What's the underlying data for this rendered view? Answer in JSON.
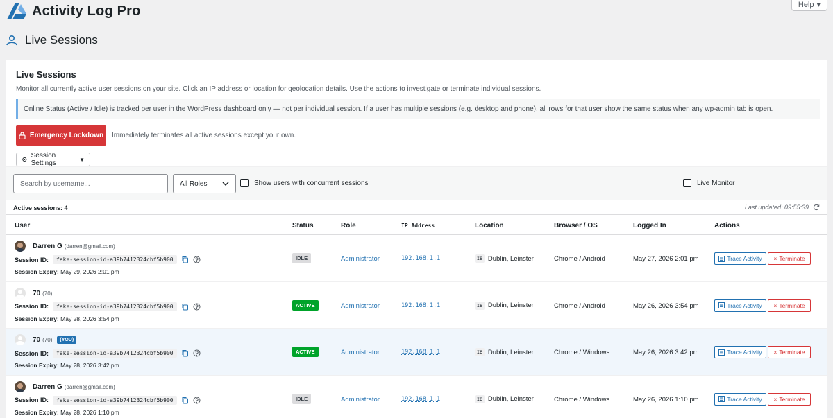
{
  "app": {
    "name": "Activity Log Pro"
  },
  "help": {
    "label": "Help"
  },
  "page": {
    "title": "Live Sessions"
  },
  "card": {
    "title": "Live Sessions",
    "description": "Monitor all currently active user sessions on your site. Click an IP address or location for geolocation details. Use the actions to investigate or terminate individual sessions.",
    "notice": "Online Status (Active / Idle) is tracked per user in the WordPress dashboard only — not per individual session. If a user has multiple sessions (e.g. desktop and phone), all rows for that user show the same status when any wp-admin tab is open."
  },
  "lockdown": {
    "button_label": "Emergency Lockdown",
    "description": "Immediately terminates all active sessions except your own."
  },
  "settings": {
    "button_label": "Session Settings"
  },
  "filters": {
    "search_placeholder": "Search by username...",
    "role_selected": "All Roles",
    "concurrent_label": "Show users with concurrent sessions",
    "live_monitor_label": "Live Monitor"
  },
  "summary": {
    "active_sessions": "Active sessions: 4",
    "last_updated": "Last updated: 09:55:39"
  },
  "table": {
    "headers": {
      "user": "User",
      "status": "Status",
      "role": "Role",
      "ip": "IP Address",
      "location": "Location",
      "browser": "Browser / OS",
      "logged_in": "Logged In",
      "actions": "Actions"
    },
    "labels": {
      "session_id": "Session ID:",
      "session_expiry": "Session Expiry:",
      "trace": "Trace Activity",
      "terminate": "Terminate",
      "you": "(YOU)"
    },
    "rows": [
      {
        "avatar": "photo",
        "name": "Darren G",
        "sub": "(darren@gmail.com)",
        "you": false,
        "session_id": "fake-session-id-a39b7412324cbf5b900",
        "expiry": "May 29, 2026 2:01 pm",
        "status": "IDLE",
        "role": "Administrator",
        "ip": "192.168.1.1",
        "country_code": "IE",
        "location": "Dublin, Leinster",
        "browser": "Chrome / Android",
        "logged_in": "May 27, 2026 2:01 pm"
      },
      {
        "avatar": "blank",
        "name": "70",
        "sub": "(70)",
        "you": false,
        "session_id": "fake-session-id-a39b7412324cbf5b900",
        "expiry": "May 28, 2026 3:54 pm",
        "status": "ACTIVE",
        "role": "Administrator",
        "ip": "192.168.1.1",
        "country_code": "IE",
        "location": "Dublin, Leinster",
        "browser": "Chrome / Android",
        "logged_in": "May 26, 2026 3:54 pm"
      },
      {
        "avatar": "blank",
        "name": "70",
        "sub": "(70)",
        "you": true,
        "session_id": "fake-session-id-a39b7412324cbf5b900",
        "expiry": "May 28, 2026 3:42 pm",
        "status": "ACTIVE",
        "role": "Administrator",
        "ip": "192.168.1.1",
        "country_code": "IE",
        "location": "Dublin, Leinster",
        "browser": "Chrome / Windows",
        "logged_in": "May 26, 2026 3:42 pm"
      },
      {
        "avatar": "photo",
        "name": "Darren G",
        "sub": "(darren@gmail.com)",
        "you": false,
        "session_id": "fake-session-id-a39b7412324cbf5b900",
        "expiry": "May 28, 2026 1:10 pm",
        "status": "IDLE",
        "role": "Administrator",
        "ip": "192.168.1.1",
        "country_code": "IE",
        "location": "Dublin, Leinster",
        "browser": "Chrome / Windows",
        "logged_in": "May 26, 2026 1:10 pm"
      }
    ]
  },
  "colors": {
    "accent": "#2271b1",
    "danger": "#d63638",
    "success": "#00a32a",
    "idle": "#dcdcde"
  }
}
